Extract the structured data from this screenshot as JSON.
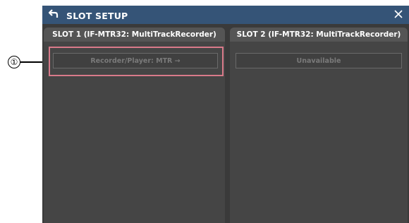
{
  "window": {
    "title": "SLOT SETUP",
    "back_icon": "back-arrow-icon",
    "close_icon": "close-icon",
    "titlebar_color": "#355477"
  },
  "slots": [
    {
      "header": "SLOT 1 (IF-MTR32: MultiTrackRecorder)",
      "button_label": "Recorder/Player: MTR →"
    },
    {
      "header": "SLOT 2 (IF-MTR32: MultiTrackRecorder)",
      "button_label": "Unavailable"
    }
  ],
  "callout": {
    "number": "①",
    "highlight_color": "#d97a8a"
  }
}
